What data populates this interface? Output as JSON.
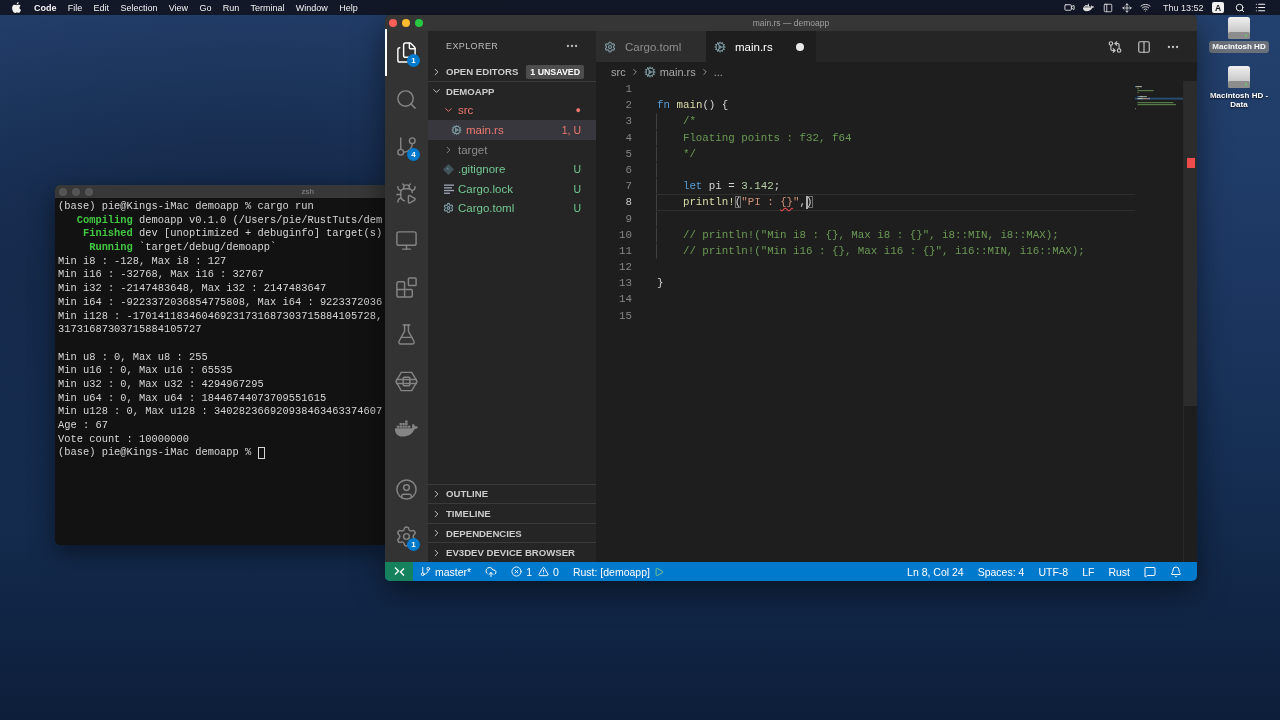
{
  "menu_bar": {
    "app_name": "Code",
    "items": [
      "File",
      "Edit",
      "Selection",
      "View",
      "Go",
      "Run",
      "Terminal",
      "Window",
      "Help"
    ],
    "clock": "Thu 13:52",
    "input_source": "A"
  },
  "desktop_icons": [
    {
      "label": "Macintosh HD",
      "selected": true
    },
    {
      "label": "Macintosh HD - Data",
      "selected": false
    }
  ],
  "terminal": {
    "title": "zsh",
    "active": false,
    "cursor": true,
    "groups": [
      {
        "lines": [
          {
            "kind": "plain",
            "text": "(base) pie@Kings-iMac demoapp % cargo run"
          },
          {
            "kind": "cargo",
            "status": "Compiling",
            "text": "demoapp v0.1.0 (/Users/pie/RustTuts/dem"
          },
          {
            "kind": "cargo",
            "status": "Finished",
            "text": "dev [unoptimized + debuginfo] target(s)"
          },
          {
            "kind": "cargo",
            "status": "Running",
            "text": "`target/debug/demoapp`"
          },
          {
            "kind": "plain",
            "text": "Min i8 : -128, Max i8 : 127"
          },
          {
            "kind": "plain",
            "text": "Min i16 : -32768, Max i16 : 32767"
          },
          {
            "kind": "plain",
            "text": "Min i32 : -2147483648, Max i32 : 2147483647"
          },
          {
            "kind": "plain",
            "text": "Min i64 : -9223372036854775808, Max i64 : 9223372036"
          },
          {
            "kind": "plain",
            "text": "Min i128 : -170141183460469231731687303715884105728,"
          },
          {
            "kind": "plain",
            "text": "31731687303715884105727"
          }
        ]
      },
      {
        "lines": [
          {
            "kind": "plain",
            "text": "Min u8 : 0, Max u8 : 255"
          },
          {
            "kind": "plain",
            "text": "Min u16 : 0, Max u16 : 65535"
          },
          {
            "kind": "plain",
            "text": "Min u32 : 0, Max u32 : 4294967295"
          },
          {
            "kind": "plain",
            "text": "Min u64 : 0, Max u64 : 18446744073709551615"
          },
          {
            "kind": "plain",
            "text": "Min u128 : 0, Max u128 : 340282366920938463463374607"
          },
          {
            "kind": "plain",
            "text": "Age : 67"
          },
          {
            "kind": "plain",
            "text": "Vote count : 10000000"
          },
          {
            "kind": "plain",
            "text": "(base) pie@Kings-iMac demoapp %"
          }
        ]
      }
    ]
  },
  "editor_window": {
    "title": "main.rs — demoapp",
    "active": true,
    "activity_bar": {
      "top": [
        {
          "kind": "explorer",
          "selected": true,
          "badge": "1"
        },
        {
          "kind": "search",
          "selected": false
        },
        {
          "kind": "scm",
          "selected": false,
          "badge": "4"
        },
        {
          "kind": "debug",
          "selected": false
        },
        {
          "kind": "remote",
          "selected": false
        },
        {
          "kind": "extensions",
          "selected": false
        },
        {
          "kind": "testing",
          "selected": false
        },
        {
          "kind": "device",
          "selected": false
        },
        {
          "kind": "docker",
          "selected": false
        }
      ],
      "bottom": [
        {
          "kind": "account",
          "selected": false
        },
        {
          "kind": "settings",
          "selected": false,
          "badge": "1"
        }
      ]
    },
    "sidebar": {
      "title": "EXPLORER",
      "open_editors": {
        "label": "OPEN EDITORS",
        "expanded": false,
        "badge": "1 UNSAVED"
      },
      "folder": {
        "label": "DEMOAPP",
        "expanded": true,
        "tree": [
          {
            "label": "src",
            "kind": "folder",
            "expanded": true,
            "selected": false,
            "color": "#f0786f",
            "decoration": "●",
            "children": [
              {
                "label": "main.rs",
                "kind": "rust",
                "selected": true,
                "color": "#f0786f",
                "decoration": "1, U"
              }
            ]
          },
          {
            "label": "target",
            "kind": "folder",
            "expanded": false,
            "selected": false,
            "color": "#8c8c8c"
          },
          {
            "label": ".gitignore",
            "kind": "gitignore",
            "selected": false,
            "color": "#73c991",
            "decoration": "U"
          },
          {
            "label": "Cargo.lock",
            "kind": "lock",
            "selected": false,
            "color": "#73c991",
            "decoration": "U"
          },
          {
            "label": "Cargo.toml",
            "kind": "toml",
            "selected": false,
            "color": "#73c991",
            "decoration": "U"
          }
        ]
      },
      "panels": [
        {
          "label": "OUTLINE",
          "expanded": false
        },
        {
          "label": "TIMELINE",
          "expanded": false
        },
        {
          "label": "DEPENDENCIES",
          "expanded": false
        },
        {
          "label": "EV3DEV DEVICE BROWSER",
          "expanded": false
        }
      ]
    },
    "tabs": [
      {
        "label": "Cargo.toml",
        "kind": "toml",
        "selected": false,
        "dirty": false
      },
      {
        "label": "main.rs",
        "kind": "rust",
        "selected": true,
        "dirty": true
      }
    ],
    "breadcrumbs": [
      {
        "label": "src",
        "kind": "folder"
      },
      {
        "label": "main.rs",
        "kind": "rust"
      },
      {
        "label": "...",
        "kind": "symbol"
      }
    ],
    "lines": [
      {
        "number": "1",
        "current": false
      },
      {
        "number": "2",
        "indented": false,
        "current": false,
        "tokens": [
          {
            "kind": "keyword",
            "text": "fn"
          },
          {
            "kind": "function",
            "text": " main"
          },
          {
            "kind": "plain",
            "text": "() {"
          }
        ]
      },
      {
        "number": "3",
        "indented": true,
        "current": false,
        "tokens": [
          {
            "kind": "comment",
            "text": "/*"
          }
        ]
      },
      {
        "number": "4",
        "indented": true,
        "current": false,
        "tokens": [
          {
            "kind": "comment",
            "text": "Floating points : f32, f64"
          }
        ]
      },
      {
        "number": "5",
        "indented": true,
        "current": false,
        "tokens": [
          {
            "kind": "comment",
            "text": "*/"
          }
        ]
      },
      {
        "number": "6",
        "current": false
      },
      {
        "number": "7",
        "indented": true,
        "current": false,
        "tokens": [
          {
            "kind": "keyword",
            "text": "let"
          },
          {
            "kind": "plain",
            "text": " pi = "
          },
          {
            "kind": "number",
            "text": "3.142"
          },
          {
            "kind": "plain",
            "text": ";"
          }
        ]
      },
      {
        "number": "8",
        "indented": true,
        "current": true,
        "tokens": [
          {
            "kind": "function",
            "text": "println!"
          },
          {
            "kind": "bracket",
            "text": "("
          },
          {
            "kind": "string",
            "text": "\"PI : "
          },
          {
            "kind": "squiggle",
            "text": "{}"
          },
          {
            "kind": "string",
            "text": "\""
          },
          {
            "kind": "plain",
            "text": ","
          },
          {
            "kind": "cursor"
          },
          {
            "kind": "bracket",
            "text": ")"
          }
        ]
      },
      {
        "number": "9",
        "current": false
      },
      {
        "number": "10",
        "indented": true,
        "current": false,
        "tokens": [
          {
            "kind": "comment",
            "text": "// println!(\"Min i8 : {}, Max i8 : {}\", i8::MIN, i8::MAX);"
          }
        ]
      },
      {
        "number": "11",
        "indented": true,
        "current": false,
        "tokens": [
          {
            "kind": "comment",
            "text": "// println!(\"Min i16 : {}, Max i16 : {}\", i16::MIN, i16::MAX);"
          }
        ]
      },
      {
        "number": "12",
        "current": false
      },
      {
        "number": "13",
        "indented": false,
        "current": false,
        "tokens": [
          {
            "kind": "plain",
            "text": "}"
          }
        ]
      },
      {
        "number": "14",
        "current": false
      },
      {
        "number": "15",
        "current": false
      }
    ],
    "status_bar": {
      "left": [
        {
          "kind": "remote"
        },
        {
          "kind": "branch",
          "label": "master*"
        },
        {
          "kind": "sync"
        },
        {
          "kind": "problems",
          "errors": "1",
          "warnings": "0"
        },
        {
          "kind": "language",
          "label": "Rust: [demoapp]"
        }
      ],
      "right": [
        {
          "kind": "text",
          "label": "Ln 8, Col 24"
        },
        {
          "kind": "text",
          "label": "Spaces: 4"
        },
        {
          "kind": "text",
          "label": "UTF-8"
        },
        {
          "kind": "text",
          "label": "LF"
        },
        {
          "kind": "text",
          "label": "Rust"
        },
        {
          "kind": "feedback"
        },
        {
          "kind": "notifications"
        }
      ]
    }
  }
}
